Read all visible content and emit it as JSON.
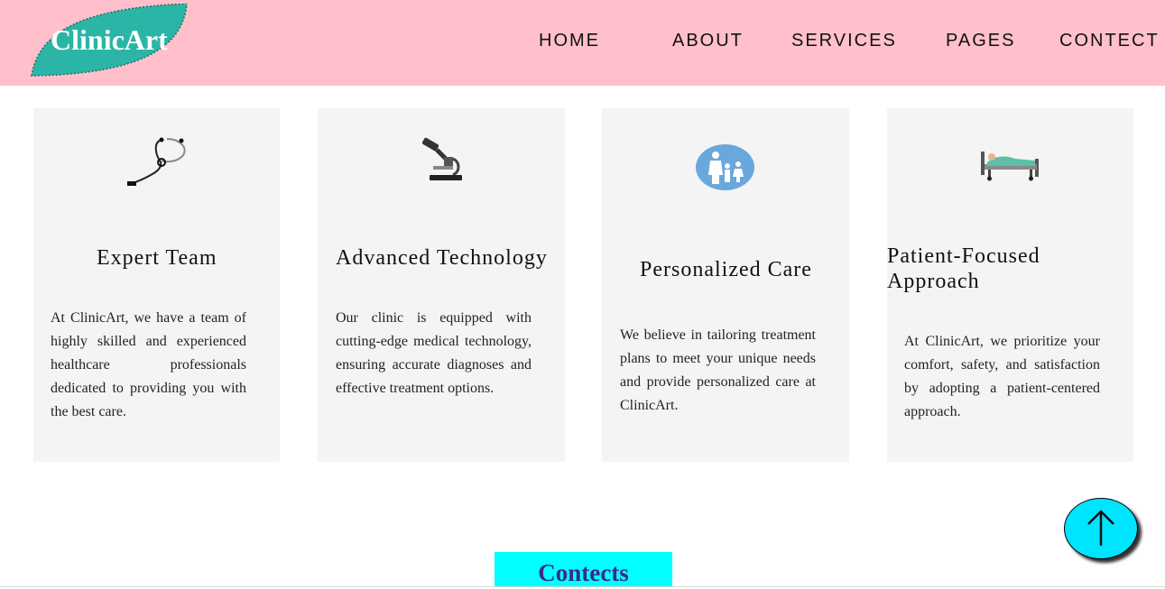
{
  "header": {
    "logo": "ClinicArt",
    "nav": [
      "HOME",
      "ABOUT",
      "SERVICES",
      "PAGES",
      "CONTECT"
    ]
  },
  "cards": [
    {
      "icon": "stethoscope-icon",
      "title": "Expert Team",
      "text": "At ClinicArt, we have a team of highly skilled and experienced healthcare professionals dedicated to providing you with the best care."
    },
    {
      "icon": "microscope-icon",
      "title": "Advanced Technology",
      "text": "Our clinic is equipped with cutting-edge medical technology, ensuring accurate diagnoses and effective treatment options."
    },
    {
      "icon": "family-care-icon",
      "title": "Personalized Care",
      "text": "We believe in tailoring treatment plans to meet your unique needs and provide personalized care at ClinicArt."
    },
    {
      "icon": "hospital-bed-icon",
      "title": "Patient-Focused Approach",
      "text": "At ClinicArt, we prioritize your comfort, safety, and satisfaction by adopting a patient-centered approach."
    }
  ],
  "contacts_heading": "Contects",
  "scroll_top_icon": "arrow-up-icon",
  "colors": {
    "header_bg": "#ffc0cb",
    "logo_leaf": "#2bb5a6",
    "card_bg": "#f4f4f4",
    "accent_cyan": "#00ffff",
    "heading_text": "#3a2a8c"
  }
}
